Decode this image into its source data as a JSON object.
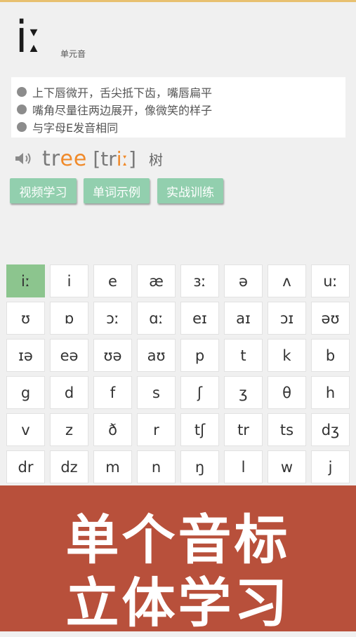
{
  "header": {
    "symbol": "iː",
    "type_label": "单元音"
  },
  "description": [
    "上下唇微开，舌尖抵下齿，嘴唇扁平",
    "嘴角尽量往两边展开，像微笑的样子",
    "与字母E发音相同"
  ],
  "example": {
    "word_plain": "tr",
    "word_hl": "ee",
    "phon_open": "[",
    "phon_plain": "tr",
    "phon_hl": "iː",
    "phon_close": "]",
    "meaning": "树"
  },
  "buttons": [
    "视频学习",
    "单词示例",
    "实战训练"
  ],
  "phonetics": [
    "iː",
    "i",
    "e",
    "æ",
    "ɜː",
    "ə",
    "ʌ",
    "uː",
    "ʊ",
    "ɒ",
    "ɔː",
    "ɑː",
    "eɪ",
    "aɪ",
    "ɔɪ",
    "əʊ",
    "ɪə",
    "eə",
    "ʊə",
    "aʊ",
    "p",
    "t",
    "k",
    "b",
    "g",
    "d",
    "f",
    "s",
    "ʃ",
    "ʒ",
    "θ",
    "h",
    "v",
    "z",
    "ð",
    "r",
    "tʃ",
    "tr",
    "ts",
    "dʒ",
    "dr",
    "dz",
    "m",
    "n",
    "ŋ",
    "l",
    "w",
    "j"
  ],
  "selected_index": 0,
  "banner": {
    "line1": "单个音标",
    "line2": "立体学习"
  },
  "colors": {
    "accent_green": "#92cfae",
    "highlight": "#f08a2a",
    "banner_bg": "#b8503b"
  }
}
